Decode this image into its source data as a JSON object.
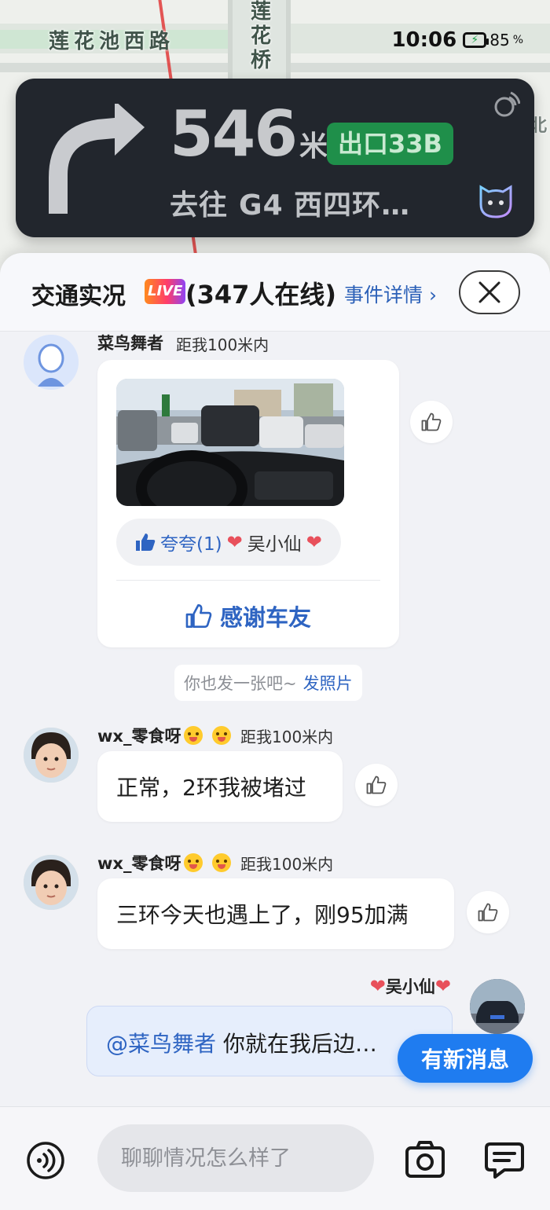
{
  "map": {
    "road_label_west": "莲花池西路",
    "road_label_bridge": "莲花桥",
    "road_label_right": "北"
  },
  "status_bar": {
    "time": "10:06",
    "battery_percent": "85",
    "battery_unit": "%"
  },
  "navigation": {
    "distance_value": "546",
    "distance_unit": "米",
    "exit_label": "出口33B",
    "destination_prefix": "去往",
    "destination": "G4 西四环…",
    "maneuver_icon": "turn-right-arrow-icon"
  },
  "panel": {
    "title": "交通实况",
    "live_badge": "LIVE",
    "online_count": "(347人在线)",
    "event_link": "事件详情",
    "close_icon": "close-icon"
  },
  "messages": [
    {
      "user": "菜鸟舞者",
      "distance": "距我100米内",
      "type": "photo",
      "praise_label": "夸夸(1)",
      "praise_user": "吴小仙",
      "thank_label": "感谢车友"
    },
    {
      "user": "wx_零食呀",
      "distance": "距我100米内",
      "text": "正常，2环我被堵过"
    },
    {
      "user": "wx_零食呀",
      "distance": "距我100米内",
      "text": "三环今天也遇上了，刚95加满"
    },
    {
      "user": "吴小仙",
      "mention": "@菜鸟舞者",
      "text": "你就在我后边…"
    }
  ],
  "hint": {
    "text": "你也发一张吧~",
    "link": "发照片"
  },
  "new_message_button": "有新消息",
  "input": {
    "placeholder": "聊聊情况怎么样了"
  },
  "colors": {
    "accent_blue": "#2e64c2",
    "nav_card_bg": "#22262d",
    "exit_badge_green": "#1f8f4a",
    "new_msg_blue": "#1f7cf0"
  }
}
